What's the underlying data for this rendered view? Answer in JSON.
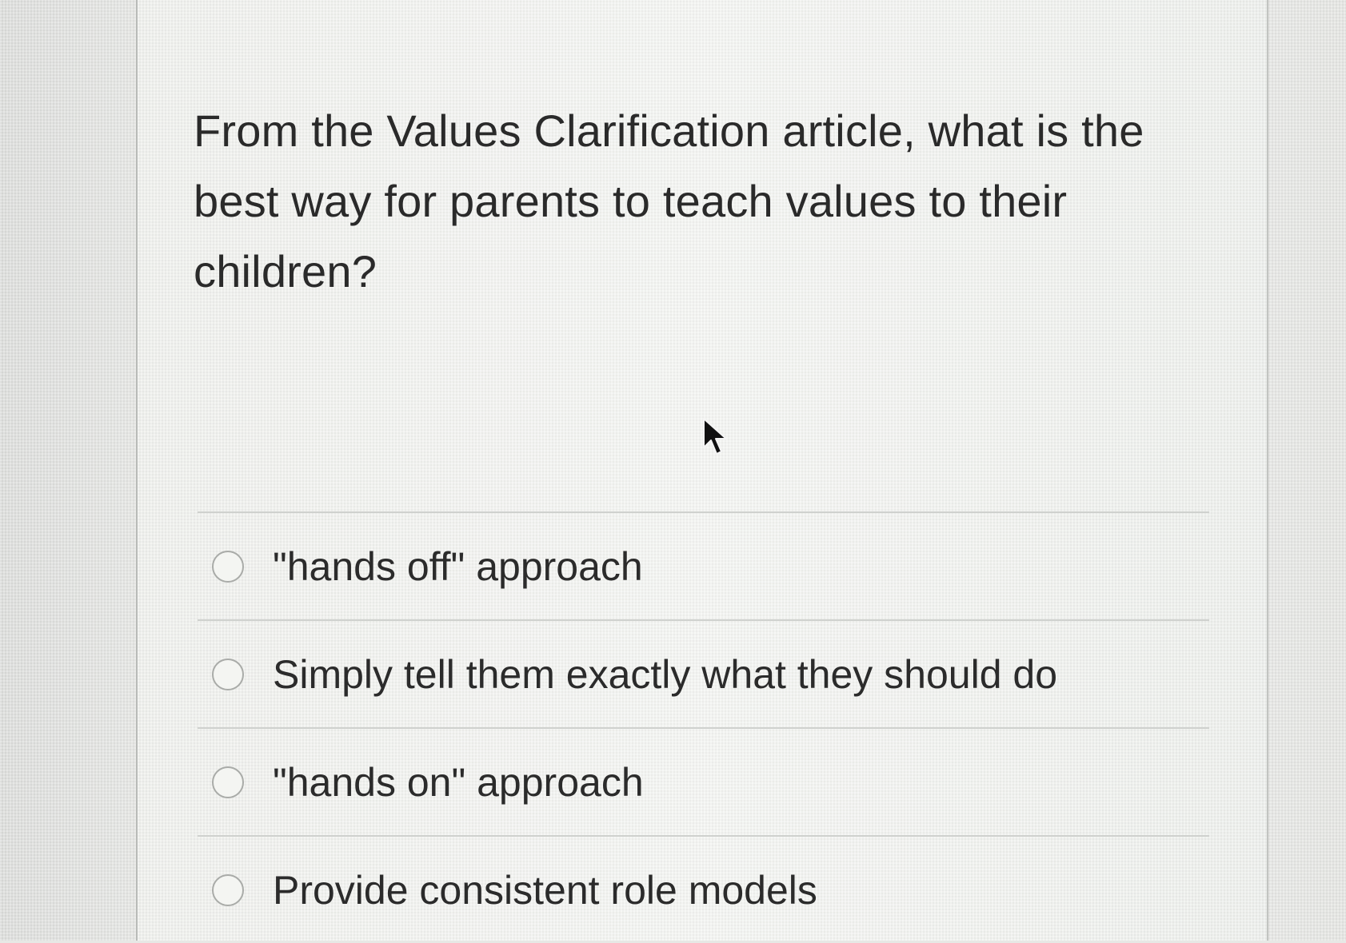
{
  "question": {
    "text": "From the Values Clarification article, what is the best way for parents to teach values to their children?"
  },
  "answers": [
    {
      "label": "\"hands off\" approach",
      "selected": false
    },
    {
      "label": "Simply tell them exactly what they should do",
      "selected": false
    },
    {
      "label": "\"hands on\" approach",
      "selected": false
    },
    {
      "label": "Provide consistent role models",
      "selected": false
    }
  ],
  "icons": {
    "radio": "radio-button-icon",
    "cursor": "mouse-pointer-icon"
  },
  "colors": {
    "page_bg": "#e7e8e5",
    "panel_bg": "#f1f2ef",
    "text": "#2b2b2b",
    "divider": "#cfd1ce",
    "radio_border": "#a9aba8"
  }
}
